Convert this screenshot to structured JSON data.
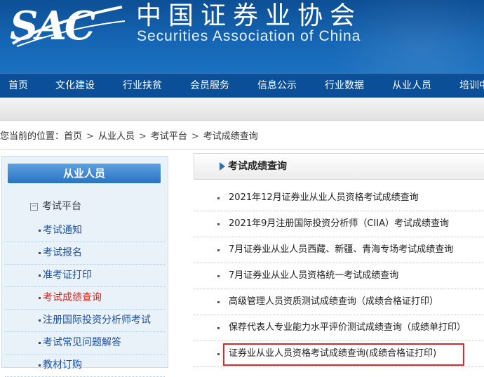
{
  "header": {
    "logo_text": "SAC",
    "title_cn": "中国证券业协会",
    "title_en": "Securities Association of China"
  },
  "nav": {
    "items": [
      "首页",
      "文化建设",
      "行业扶贫",
      "会员服务",
      "信息公示",
      "行业数据",
      "从业人员",
      "培训中"
    ]
  },
  "breadcrumb": {
    "prefix": "您当前的位置：",
    "items": [
      "首页",
      "从业人员",
      "考试平台",
      "考试成绩查询"
    ],
    "separator": ">"
  },
  "sidebar": {
    "heading": "从业人员",
    "group": "考试平台",
    "items": [
      "考试通知",
      "考试报名",
      "准考证打印",
      "考试成绩查询",
      "注册国际投资分析师考试",
      "考试常见问题解答",
      "教材订购"
    ],
    "active_index": 3
  },
  "main": {
    "heading": "考试成绩查询",
    "links": [
      "2021年12月证券业从业人员资格考试成绩查询",
      "2021年9月注册国际投资分析师（CIIA）考试成绩查询",
      "7月证券业从业人员西藏、新疆、青海专场考试成绩查询",
      "7月证券业从业人员资格统一考试成绩查询",
      "高级管理人员资质测试成绩查询（成绩合格证打印）",
      "保荐代表人专业能力水平评价测试成绩查询（成绩单打印）",
      "证券业从业人员资格考试成绩查询(成绩合格证打印)"
    ],
    "highlighted_index": 6
  },
  "colors": {
    "banner": "#1667b6",
    "nav": "#0a4f97",
    "link": "#1b4f9c",
    "active": "#d9261c",
    "highlight_box": "#e0272c"
  }
}
